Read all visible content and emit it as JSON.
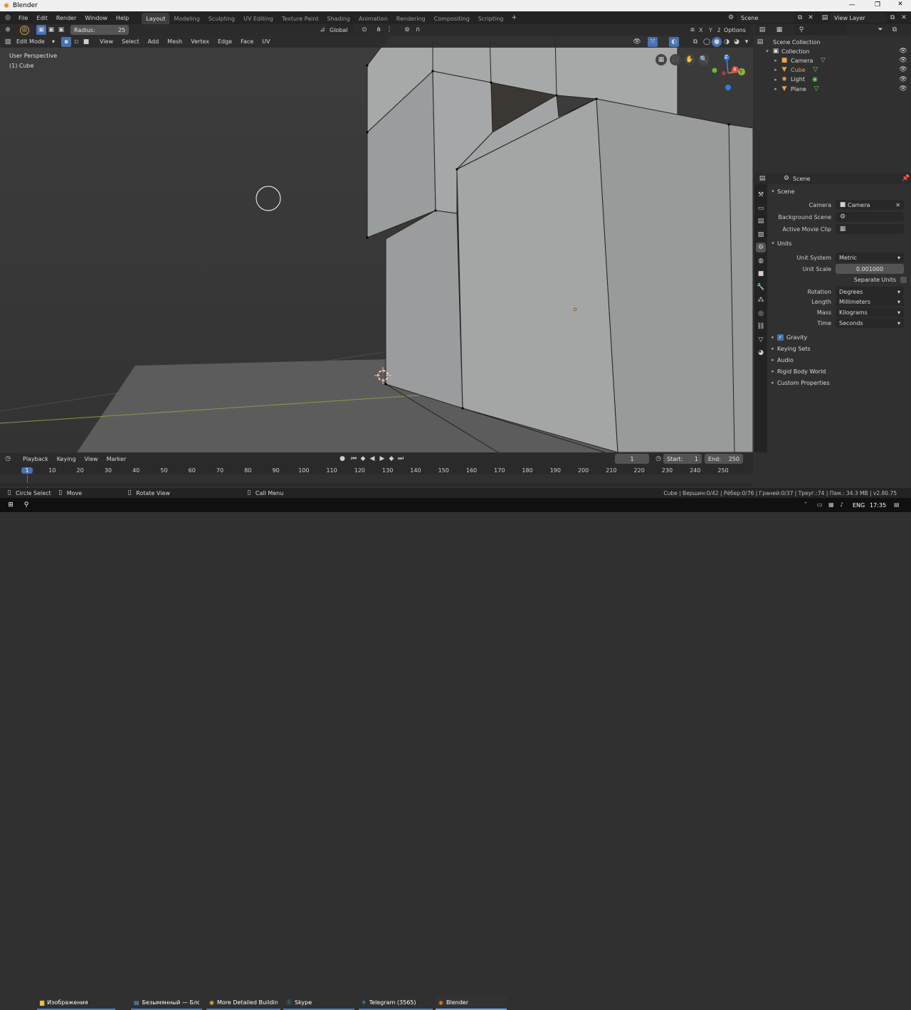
{
  "window": {
    "title": "Blender"
  },
  "menu": [
    "File",
    "Edit",
    "Render",
    "Window",
    "Help"
  ],
  "workspaces": [
    "Layout",
    "Modeling",
    "Sculpting",
    "UV Editing",
    "Texture Paint",
    "Shading",
    "Animation",
    "Rendering",
    "Compositing",
    "Scripting"
  ],
  "active_workspace": "Layout",
  "scene_name": "Scene",
  "view_layer": "View Layer",
  "tool_header": {
    "radius_label": "Radius:",
    "radius_value": "25",
    "transform_orientation": "Global",
    "options": "Options"
  },
  "viewport_header": {
    "mode": "Edit Mode",
    "menus": [
      "View",
      "Select",
      "Add",
      "Mesh",
      "Vertex",
      "Edge",
      "Face",
      "UV"
    ]
  },
  "viewport": {
    "perspective": "User Perspective",
    "object": "(1) Cube"
  },
  "gizmo": {
    "x": "X",
    "y": "Y",
    "z": "Z"
  },
  "outliner": {
    "root": "Scene Collection",
    "collection": "Collection",
    "items": [
      {
        "name": "Camera",
        "active": false,
        "color": "#d9d9d9"
      },
      {
        "name": "Cube",
        "active": true,
        "color": "#f0a050"
      },
      {
        "name": "Light",
        "active": false,
        "color": "#d9d9d9"
      },
      {
        "name": "Plane",
        "active": false,
        "color": "#d9d9d9"
      }
    ]
  },
  "properties": {
    "context": "Scene",
    "scene_section": "Scene",
    "camera_label": "Camera",
    "camera_value": "Camera",
    "bg_scene_label": "Background Scene",
    "movie_clip_label": "Active Movie Clip",
    "units_section": "Units",
    "unit_system_label": "Unit System",
    "unit_system": "Metric",
    "unit_scale_label": "Unit Scale",
    "unit_scale": "0.001000",
    "separate_units": "Separate Units",
    "rotation_label": "Rotation",
    "rotation": "Degrees",
    "length_label": "Length",
    "length": "Millimeters",
    "mass_label": "Mass",
    "mass": "Kilograms",
    "time_label": "Time",
    "time": "Seconds",
    "gravity": "Gravity",
    "collapsed": [
      "Keying Sets",
      "Audio",
      "Rigid Body World",
      "Custom Properties"
    ]
  },
  "timeline": {
    "menus": [
      "Playback",
      "Keying",
      "View",
      "Marker"
    ],
    "current_frame": "1",
    "start_label": "Start:",
    "start": "1",
    "end_label": "End:",
    "end": "250",
    "ticks": [
      "1",
      "10",
      "20",
      "30",
      "40",
      "50",
      "60",
      "70",
      "80",
      "90",
      "100",
      "110",
      "120",
      "130",
      "140",
      "150",
      "160",
      "170",
      "180",
      "190",
      "200",
      "210",
      "220",
      "230",
      "240",
      "250"
    ]
  },
  "status_bar": {
    "left": [
      "Circle Select",
      "Move",
      "Rotate View",
      "Call Menu"
    ],
    "right": "Cube | Вершин:0/42 | Рёбер:0/76 | Граней:0/37 | Треуг.:74 | Пам.: 34.3 MB | v2.80.75"
  },
  "taskbar": {
    "items": [
      "Изображения",
      "Безымянный — Бло...",
      "More Detailed Buildin...",
      "Skype",
      "Telegram (3565)",
      "Blender"
    ],
    "lang": "ENG",
    "time": "17:35"
  },
  "colors": {
    "accent": "#4772b3",
    "active_object": "#f0a050",
    "header": "#232323",
    "panel": "#303030"
  }
}
